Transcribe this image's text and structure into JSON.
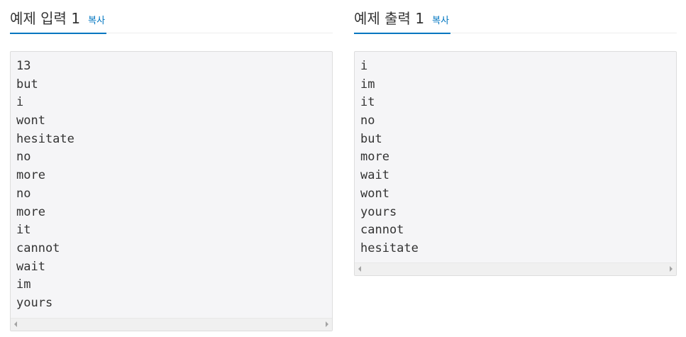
{
  "input_panel": {
    "title": "예제 입력 1",
    "copy_label": "복사",
    "lines": [
      "13",
      "but",
      "i",
      "wont",
      "hesitate",
      "no",
      "more",
      "no",
      "more",
      "it",
      "cannot",
      "wait",
      "im",
      "yours"
    ]
  },
  "output_panel": {
    "title": "예제 출력 1",
    "copy_label": "복사",
    "lines": [
      "i",
      "im",
      "it",
      "no",
      "but",
      "more",
      "wait",
      "wont",
      "yours",
      "cannot",
      "hesitate"
    ]
  },
  "colors": {
    "accent": "#0076c0",
    "text": "#333333",
    "sample_background": "#f5f5f7"
  }
}
